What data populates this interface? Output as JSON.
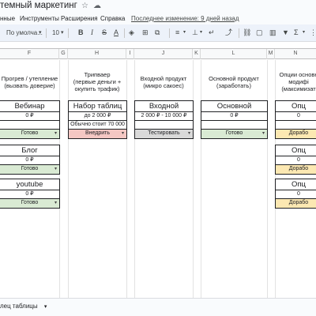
{
  "app": {
    "doc_title": "темный маркетинг",
    "star_icon": "star-icon",
    "cloud_icon": "cloud-icon"
  },
  "menu": {
    "items": [
      "нные",
      "Инструменты",
      "Расширения",
      "Справка"
    ],
    "last_edit": "Последнее изменение: 9 дней назад"
  },
  "toolbar": {
    "font": "По умолча...",
    "font_size": "10",
    "icons": [
      "bold-icon",
      "italic-icon",
      "strikethrough-icon",
      "text-color-icon",
      "fill-color-icon",
      "borders-icon",
      "merge-cells-icon",
      "horizontal-align-icon",
      "vertical-align-icon",
      "text-wrap-icon",
      "text-rotation-icon",
      "link-icon",
      "comment-icon",
      "chart-icon",
      "filter-icon",
      "functions-icon",
      "more-icon"
    ]
  },
  "columns": [
    "F",
    "G",
    "H",
    "I",
    "J",
    "K",
    "L",
    "M",
    "N"
  ],
  "headings": {
    "f": "Прогрев / утепление\n(вызвать доверие)",
    "h": "Трипваер\n(первые деньги +\nокупить трафик)",
    "j": "Входной продукт\n(микро сакоес)",
    "l": "Основной продукт\n(заработать)",
    "n": "Опции основн\nмодифі\n(максимизат"
  },
  "cards": {
    "webinar": {
      "title": "Вебинар",
      "price": "0 ₽",
      "status": "Готово"
    },
    "blog": {
      "title": "Блог",
      "price": "0 ₽",
      "status": "Готово"
    },
    "youtube": {
      "title": "youtube",
      "price": "0 ₽",
      "status": "Готово"
    },
    "tables": {
      "title": "Набор таблиц",
      "price": "до 2 000 ₽",
      "note": "Обычно стоит 70 000",
      "status": "Внедрить"
    },
    "entry": {
      "title": "Входной",
      "price": "2 000 ₽ - 10 000 ₽",
      "status": "Тестировать"
    },
    "main": {
      "title": "Основной",
      "price": "0 ₽",
      "status": "Готово"
    },
    "opt1": {
      "title": "Опц",
      "price": "0",
      "status": "Дорабо"
    },
    "opt2": {
      "title": "Опц",
      "price": "0",
      "status": "Дорабо"
    },
    "opt3": {
      "title": "Опц",
      "price": "0",
      "status": "Дорабо"
    }
  },
  "sheet": {
    "tab_label": "лец таблицы"
  },
  "colors": {
    "ready": "#d9ead3",
    "implement": "#f4c7c3",
    "testing": "#d9d9d9",
    "rework": "#fce8b2"
  }
}
